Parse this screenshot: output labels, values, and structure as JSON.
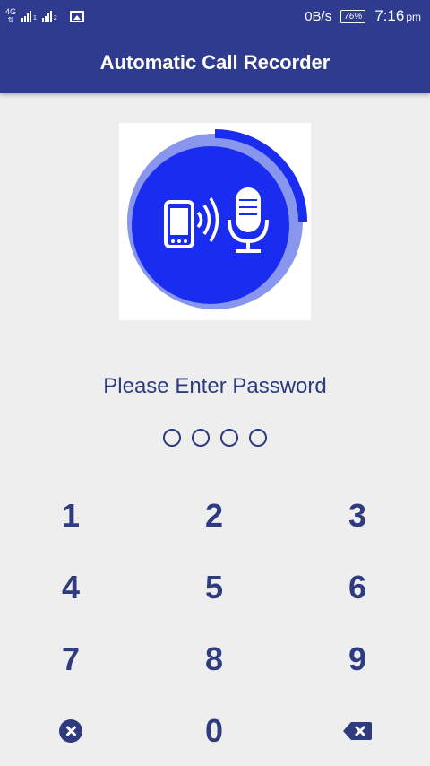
{
  "status_bar": {
    "network_label": "4G",
    "sim_slot_1": "1",
    "sim_slot_2": "2",
    "data_speed": "0B/s",
    "battery": "76%",
    "time": "7:16",
    "ampm": "pm"
  },
  "app_bar": {
    "title": "Automatic Call Recorder"
  },
  "lock": {
    "prompt": "Please Enter Password",
    "pin_length": 4,
    "pin_entered": 0
  },
  "keypad": {
    "k1": "1",
    "k2": "2",
    "k3": "3",
    "k4": "4",
    "k5": "5",
    "k6": "6",
    "k7": "7",
    "k8": "8",
    "k9": "9",
    "k0": "0",
    "clear_icon": "clear-circle-icon",
    "backspace_icon": "backspace-icon"
  },
  "colors": {
    "primary": "#2e3b8f",
    "logo_blue": "#1a2cf0",
    "text_accent": "#2e3b7f",
    "background": "#eeeeee"
  }
}
